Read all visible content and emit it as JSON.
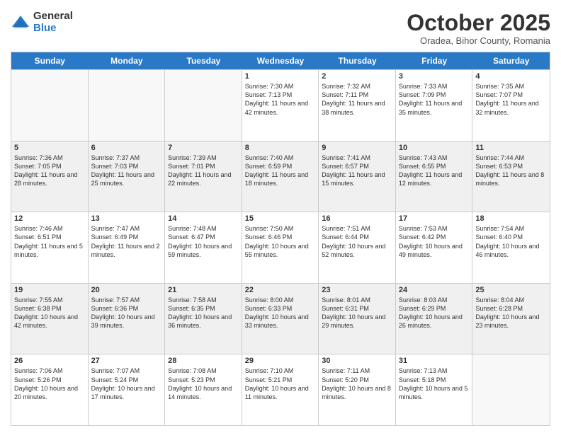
{
  "logo": {
    "general": "General",
    "blue": "Blue"
  },
  "header": {
    "month": "October 2025",
    "location": "Oradea, Bihor County, Romania"
  },
  "days": [
    "Sunday",
    "Monday",
    "Tuesday",
    "Wednesday",
    "Thursday",
    "Friday",
    "Saturday"
  ],
  "rows": [
    [
      {
        "day": "",
        "info": ""
      },
      {
        "day": "",
        "info": ""
      },
      {
        "day": "",
        "info": ""
      },
      {
        "day": "1",
        "info": "Sunrise: 7:30 AM\nSunset: 7:13 PM\nDaylight: 11 hours and 42 minutes."
      },
      {
        "day": "2",
        "info": "Sunrise: 7:32 AM\nSunset: 7:11 PM\nDaylight: 11 hours and 38 minutes."
      },
      {
        "day": "3",
        "info": "Sunrise: 7:33 AM\nSunset: 7:09 PM\nDaylight: 11 hours and 35 minutes."
      },
      {
        "day": "4",
        "info": "Sunrise: 7:35 AM\nSunset: 7:07 PM\nDaylight: 11 hours and 32 minutes."
      }
    ],
    [
      {
        "day": "5",
        "info": "Sunrise: 7:36 AM\nSunset: 7:05 PM\nDaylight: 11 hours and 28 minutes."
      },
      {
        "day": "6",
        "info": "Sunrise: 7:37 AM\nSunset: 7:03 PM\nDaylight: 11 hours and 25 minutes."
      },
      {
        "day": "7",
        "info": "Sunrise: 7:39 AM\nSunset: 7:01 PM\nDaylight: 11 hours and 22 minutes."
      },
      {
        "day": "8",
        "info": "Sunrise: 7:40 AM\nSunset: 6:59 PM\nDaylight: 11 hours and 18 minutes."
      },
      {
        "day": "9",
        "info": "Sunrise: 7:41 AM\nSunset: 6:57 PM\nDaylight: 11 hours and 15 minutes."
      },
      {
        "day": "10",
        "info": "Sunrise: 7:43 AM\nSunset: 6:55 PM\nDaylight: 11 hours and 12 minutes."
      },
      {
        "day": "11",
        "info": "Sunrise: 7:44 AM\nSunset: 6:53 PM\nDaylight: 11 hours and 8 minutes."
      }
    ],
    [
      {
        "day": "12",
        "info": "Sunrise: 7:46 AM\nSunset: 6:51 PM\nDaylight: 11 hours and 5 minutes."
      },
      {
        "day": "13",
        "info": "Sunrise: 7:47 AM\nSunset: 6:49 PM\nDaylight: 11 hours and 2 minutes."
      },
      {
        "day": "14",
        "info": "Sunrise: 7:48 AM\nSunset: 6:47 PM\nDaylight: 10 hours and 59 minutes."
      },
      {
        "day": "15",
        "info": "Sunrise: 7:50 AM\nSunset: 6:46 PM\nDaylight: 10 hours and 55 minutes."
      },
      {
        "day": "16",
        "info": "Sunrise: 7:51 AM\nSunset: 6:44 PM\nDaylight: 10 hours and 52 minutes."
      },
      {
        "day": "17",
        "info": "Sunrise: 7:53 AM\nSunset: 6:42 PM\nDaylight: 10 hours and 49 minutes."
      },
      {
        "day": "18",
        "info": "Sunrise: 7:54 AM\nSunset: 6:40 PM\nDaylight: 10 hours and 46 minutes."
      }
    ],
    [
      {
        "day": "19",
        "info": "Sunrise: 7:55 AM\nSunset: 6:38 PM\nDaylight: 10 hours and 42 minutes."
      },
      {
        "day": "20",
        "info": "Sunrise: 7:57 AM\nSunset: 6:36 PM\nDaylight: 10 hours and 39 minutes."
      },
      {
        "day": "21",
        "info": "Sunrise: 7:58 AM\nSunset: 6:35 PM\nDaylight: 10 hours and 36 minutes."
      },
      {
        "day": "22",
        "info": "Sunrise: 8:00 AM\nSunset: 6:33 PM\nDaylight: 10 hours and 33 minutes."
      },
      {
        "day": "23",
        "info": "Sunrise: 8:01 AM\nSunset: 6:31 PM\nDaylight: 10 hours and 29 minutes."
      },
      {
        "day": "24",
        "info": "Sunrise: 8:03 AM\nSunset: 6:29 PM\nDaylight: 10 hours and 26 minutes."
      },
      {
        "day": "25",
        "info": "Sunrise: 8:04 AM\nSunset: 6:28 PM\nDaylight: 10 hours and 23 minutes."
      }
    ],
    [
      {
        "day": "26",
        "info": "Sunrise: 7:06 AM\nSunset: 5:26 PM\nDaylight: 10 hours and 20 minutes."
      },
      {
        "day": "27",
        "info": "Sunrise: 7:07 AM\nSunset: 5:24 PM\nDaylight: 10 hours and 17 minutes."
      },
      {
        "day": "28",
        "info": "Sunrise: 7:08 AM\nSunset: 5:23 PM\nDaylight: 10 hours and 14 minutes."
      },
      {
        "day": "29",
        "info": "Sunrise: 7:10 AM\nSunset: 5:21 PM\nDaylight: 10 hours and 11 minutes."
      },
      {
        "day": "30",
        "info": "Sunrise: 7:11 AM\nSunset: 5:20 PM\nDaylight: 10 hours and 8 minutes."
      },
      {
        "day": "31",
        "info": "Sunrise: 7:13 AM\nSunset: 5:18 PM\nDaylight: 10 hours and 5 minutes."
      },
      {
        "day": "",
        "info": ""
      }
    ]
  ]
}
